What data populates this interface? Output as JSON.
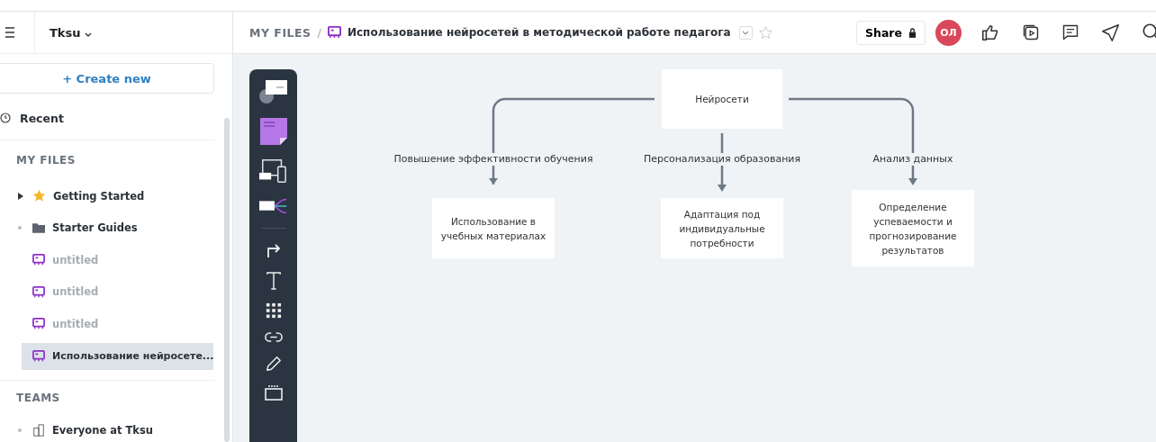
{
  "workspace": {
    "name": "Tksu"
  },
  "sidebar": {
    "create_label": "+ Create new",
    "recent_label": "Recent",
    "my_files": {
      "title": "MY FILES",
      "items": [
        {
          "kind": "star",
          "label": "Getting Started",
          "selected": false,
          "dimmed": false
        },
        {
          "kind": "folder",
          "label": "Starter Guides",
          "selected": false,
          "dimmed": false
        },
        {
          "kind": "board",
          "label": "untitled",
          "selected": false,
          "dimmed": true
        },
        {
          "kind": "board",
          "label": "untitled",
          "selected": false,
          "dimmed": true
        },
        {
          "kind": "board",
          "label": "untitled",
          "selected": false,
          "dimmed": true
        },
        {
          "kind": "board",
          "label": "Использование нейросете...",
          "selected": true,
          "dimmed": false
        }
      ]
    },
    "teams": {
      "title": "TEAMS",
      "items": [
        {
          "kind": "team",
          "label": "Everyone at Tksu",
          "selected": false,
          "dimmed": false
        }
      ]
    }
  },
  "header": {
    "breadcrumb": "MY FILES",
    "separator": "/",
    "title": "Использование нейросетей в методической работе педагога",
    "share_label": "Share",
    "avatar": "ОЛ"
  },
  "diagram": {
    "root": "Нейросети",
    "branches": [
      {
        "label": "Повышение эффективности обучения",
        "node": "Использование в учебных материалах"
      },
      {
        "label": "Персонализация образования",
        "node": "Адаптация под индивидуальные потребности"
      },
      {
        "label": "Анализ данных",
        "node": "Определение успеваемости и прогнозирование результатов"
      }
    ]
  }
}
